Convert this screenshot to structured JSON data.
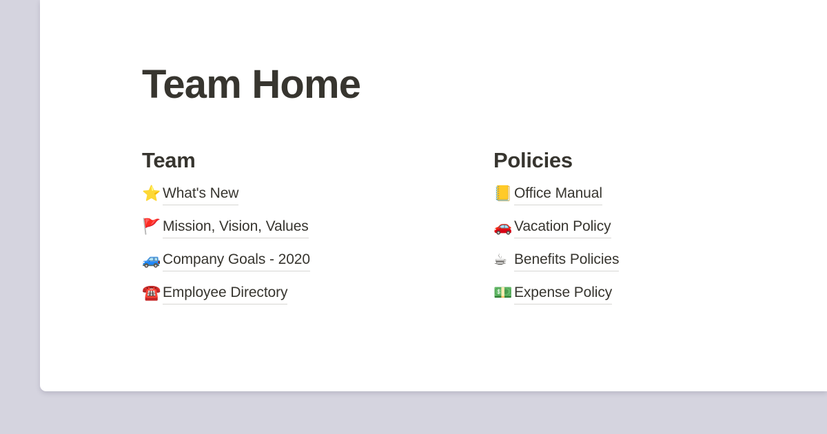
{
  "theme": {
    "background_color": "#d5d4df",
    "card_color": "#ffffff",
    "text_color": "#37352f",
    "underline_color": "#d7d6d3"
  },
  "page": {
    "title": "Team Home"
  },
  "columns": [
    {
      "heading": "Team",
      "links": [
        {
          "icon": "star-icon",
          "emoji": "⭐",
          "label": "What's New"
        },
        {
          "icon": "triangular-flag-icon",
          "emoji": "🚩",
          "label": "Mission, Vision, Values"
        },
        {
          "icon": "recreational-vehicle-icon",
          "emoji": "🚙",
          "label": "Company Goals - 2020"
        },
        {
          "icon": "telephone-icon",
          "emoji": "☎️",
          "label": "Employee Directory"
        }
      ]
    },
    {
      "heading": "Policies",
      "links": [
        {
          "icon": "notebook-icon",
          "emoji": "📒",
          "label": "Office Manual"
        },
        {
          "icon": "automobile-icon",
          "emoji": "🚗",
          "label": "Vacation Policy"
        },
        {
          "icon": "hot-beverage-icon",
          "emoji": "☕",
          "label": "Benefits Policies"
        },
        {
          "icon": "dollar-banknote-icon",
          "emoji": "💵",
          "label": "Expense Policy"
        }
      ]
    }
  ]
}
